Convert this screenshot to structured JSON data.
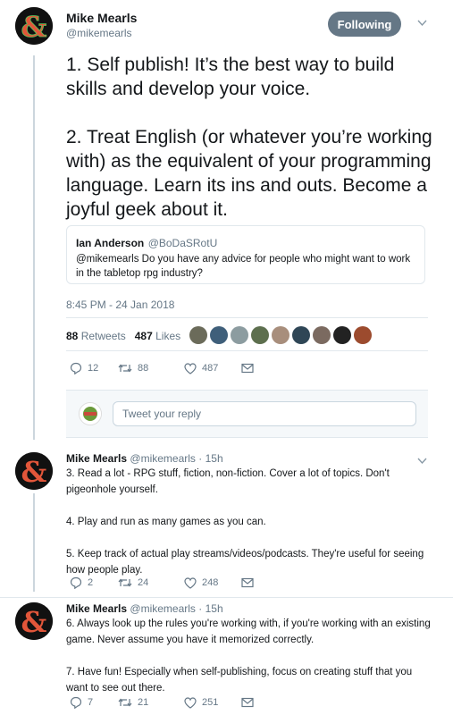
{
  "main_tweet": {
    "author_name": "Mike Mearls",
    "author_handle": "@mikemearls",
    "follow_label": "Following",
    "text": "1. Self publish! It’s the best way to build skills and develop your voice.\n\n2. Treat English (or whatever you’re working with) as the equivalent of your programming language. Learn its ins and outs. Become a joyful geek about it.",
    "quoted": {
      "name": "Ian Anderson",
      "handle": "@BoDaSRotU",
      "text": "@mikemearls Do you have any advice for people who might want to work in the tabletop rpg industry?"
    },
    "timestamp": "8:45 PM - 24 Jan 2018",
    "retweets_count": "88",
    "retweets_label": "Retweets",
    "likes_count": "487",
    "likes_label": "Likes",
    "actions": {
      "replies": "12",
      "retweets": "88",
      "likes": "487"
    }
  },
  "reply_box": {
    "placeholder": "Tweet your reply"
  },
  "replies": [
    {
      "author_name": "Mike Mearls",
      "author_handle": "@mikemearls",
      "time": "· 15h",
      "text": "3. Read a lot - RPG stuff, fiction, non-fiction. Cover a lot of topics. Don't pigeonhole yourself.\n\n4. Play and run as many games as you can.\n\n5. Keep track of actual play streams/videos/podcasts. They're useful for seeing how people play.",
      "actions": {
        "replies": "2",
        "retweets": "24",
        "likes": "248"
      }
    },
    {
      "author_name": "Mike Mearls",
      "author_handle": "@mikemearls",
      "time": "· 15h",
      "text": "6. Always look up the rules you're working with, if you're working with an existing game. Never assume you have it memorized correctly.\n\n7. Have fun! Especially when self-publishing, focus on creating stuff that you want to see out there.",
      "actions": {
        "replies": "7",
        "retweets": "21",
        "likes": "251"
      }
    }
  ],
  "colors": {
    "text": "#14171a",
    "secondary": "#657786",
    "border": "#e1e8ed",
    "follow_bg": "#657786"
  }
}
